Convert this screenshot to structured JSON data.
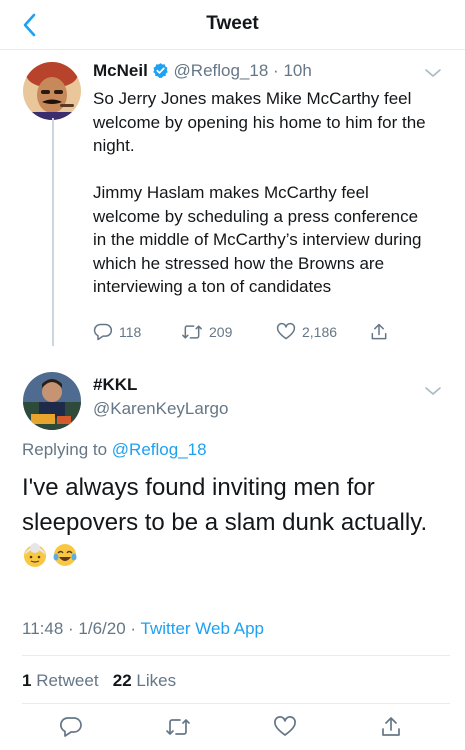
{
  "header": {
    "title": "Tweet"
  },
  "tweet1": {
    "name": "McNeil",
    "handle": "@Reflog_18",
    "separator": "·",
    "time": "10h",
    "text": "So Jerry Jones makes Mike McCarthy  feel welcome by opening his home to him for the night.\n\nJimmy Haslam makes McCarthy feel welcome by scheduling a press conference in the middle of McCarthy’s interview during which he stressed how the Browns are interviewing a ton of candidates",
    "replies": "118",
    "retweets": "209",
    "likes": "2,186"
  },
  "tweet2": {
    "name": "#KKL",
    "handle": "@KarenKeyLargo",
    "replying_prefix": "Replying to",
    "replying_to": "@Reflog_18",
    "text": "I've always found inviting men for sleepovers to be a slam dunk actually.",
    "emojis": [
      "👵",
      "😂"
    ],
    "time": "11:48",
    "date": "1/6/20",
    "separator": "·",
    "app": "Twitter Web App",
    "retweet_count": "1",
    "retweet_label": "Retweet",
    "like_count": "22",
    "like_label": "Likes"
  },
  "colors": {
    "accent": "#1da1f2",
    "muted": "#657786",
    "text": "#14171a",
    "divider": "#e6ecf0"
  },
  "icons": [
    "back-arrow-icon",
    "verified-badge-icon",
    "chevron-down-icon",
    "reply-icon",
    "retweet-icon",
    "like-icon",
    "share-icon"
  ]
}
